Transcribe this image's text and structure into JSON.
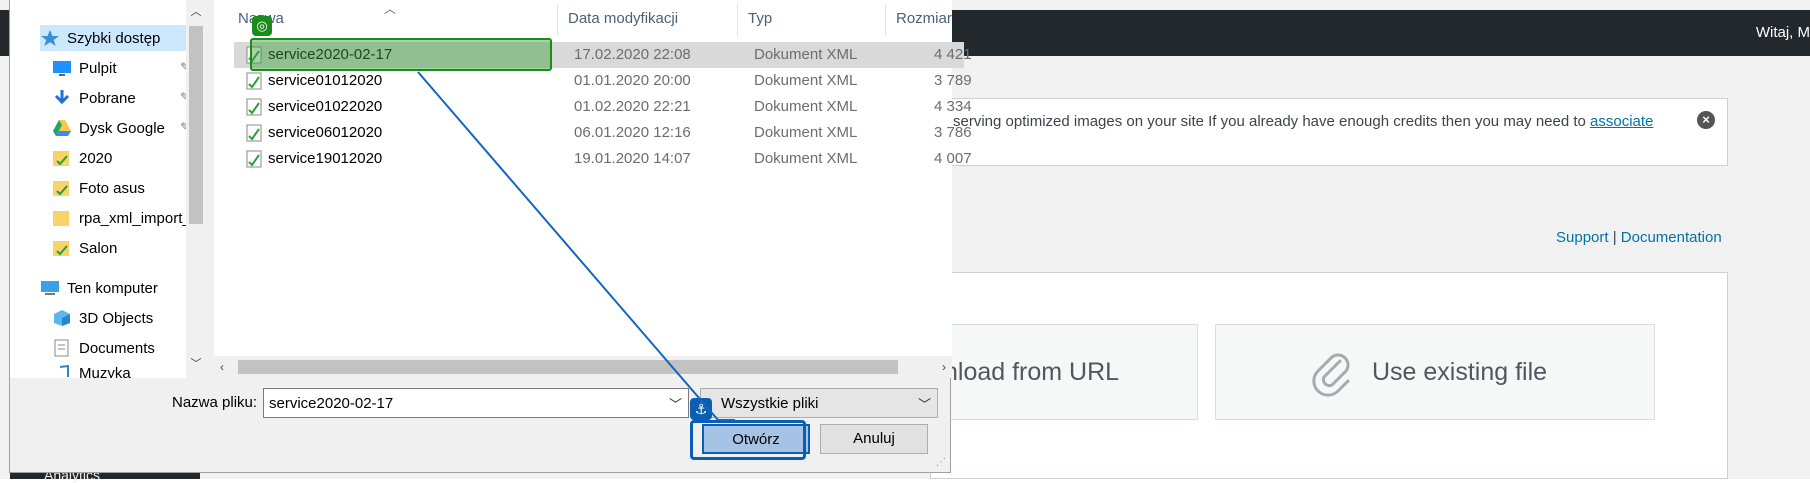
{
  "wp": {
    "greeting": "Witaj, M",
    "notice_text": "serving optimized images on your site If you already have enough credits then you may need to ",
    "notice_link": "associate",
    "support": "Support",
    "separator": " | ",
    "documentation": "Documentation",
    "card_url": "nload from URL",
    "card_existing": "Use existing file",
    "sidebar_analytics": "Analytics"
  },
  "dialog": {
    "nav": [
      {
        "label": "Szybki dostęp",
        "icon": "star-icon"
      },
      {
        "label": "Pulpit",
        "icon": "desktop-icon",
        "pinned": true
      },
      {
        "label": "Pobrane",
        "icon": "download-icon",
        "pinned": true
      },
      {
        "label": "Dysk Google",
        "icon": "google-drive-icon",
        "pinned": true
      },
      {
        "label": "2020",
        "icon": "folder-icon"
      },
      {
        "label": "Foto asus",
        "icon": "folder-icon"
      },
      {
        "label": "rpa_xml_import_",
        "icon": "folder-icon"
      },
      {
        "label": "Salon",
        "icon": "folder-icon"
      },
      {
        "label": "Ten komputer",
        "icon": "computer-icon"
      },
      {
        "label": "3D Objects",
        "icon": "cube-icon"
      },
      {
        "label": "Documents",
        "icon": "document-icon"
      },
      {
        "label": "Muzyka",
        "icon": "music-icon"
      }
    ],
    "columns": [
      "Nazwa",
      "Data modyfikacji",
      "Typ",
      "Rozmiar"
    ],
    "files": [
      {
        "name": "service2020-02-17",
        "date": "17.02.2020 22:08",
        "type": "Dokument XML",
        "size": "4 421"
      },
      {
        "name": "service01012020",
        "date": "01.01.2020 20:00",
        "type": "Dokument XML",
        "size": "3 789"
      },
      {
        "name": "service01022020",
        "date": "01.02.2020 22:21",
        "type": "Dokument XML",
        "size": "4 334"
      },
      {
        "name": "service06012020",
        "date": "06.01.2020 12:16",
        "type": "Dokument XML",
        "size": "3 786"
      },
      {
        "name": "service19012020",
        "date": "19.01.2020 14:07",
        "type": "Dokument XML",
        "size": "4 007"
      }
    ],
    "filename_label": "Nazwa pliku:",
    "filename_value": "service2020-02-17",
    "filetype_value": "Wszystkie pliki",
    "open_label": "Otwórz",
    "cancel_label": "Anuluj"
  },
  "colors": {
    "highlight": "#1a8c1a",
    "anchor": "#0a5fb4",
    "wp_link": "#0073aa"
  }
}
